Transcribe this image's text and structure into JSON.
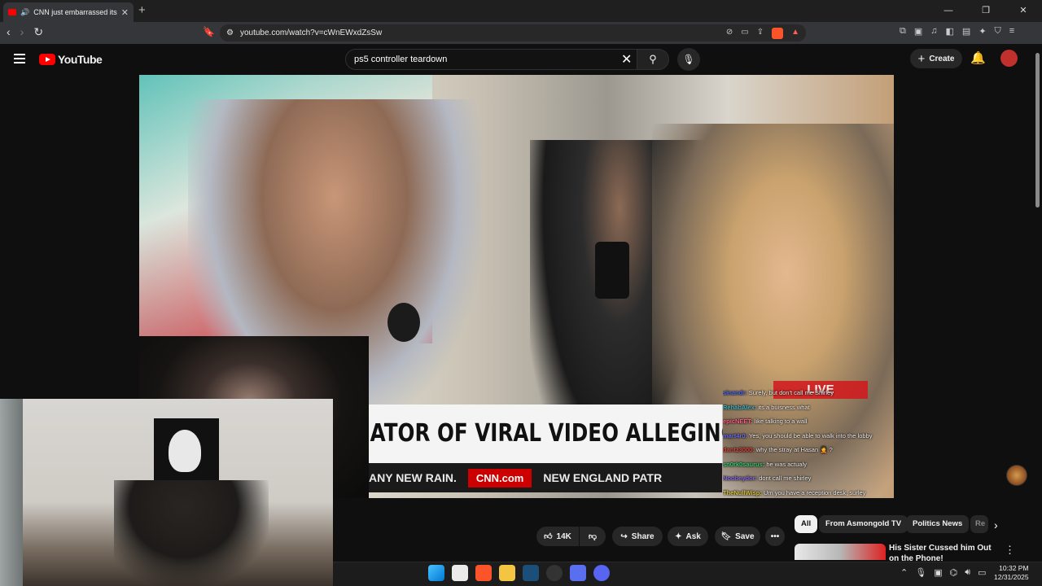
{
  "browser": {
    "tab_title": "CNN just embarrassed itself..",
    "tab_close": "✕",
    "new_tab": "+",
    "window_controls": [
      "—",
      "❐",
      "✕"
    ],
    "nav": [
      "‹",
      "›",
      "↻"
    ],
    "url": "youtube.com/watch?v=cWnEWxdZsSw"
  },
  "youtube": {
    "logo_text": "YouTube",
    "search_query": "ps5 controller teardown",
    "search_clear": "✕",
    "create_label": "Create",
    "create_plus": "+"
  },
  "video": {
    "chyron": "ATOR OF VIRAL VIDEO ALLEGING FRAUD IN MN",
    "ticker_pre": "ANY NEW RAIN.",
    "ticker_brand": "CNN.com",
    "ticker_post": "NEW ENGLAND PATR",
    "live_badge": "LIVE"
  },
  "chat": [
    {
      "user": "sinandr:",
      "msg": "Surely, but don't call me Shirley",
      "color": "#4b6bff"
    },
    {
      "user": "RehabAlex:",
      "msg": "its a buisness what",
      "color": "#3bb6c9"
    },
    {
      "user": "epicNEET:",
      "msg": "like talking to a wall",
      "color": "#ff5f8a"
    },
    {
      "user": "mart4r0:",
      "msg": "Yes, you should be able to walk into the lobby",
      "color": "#6e6ef0"
    },
    {
      "user": "dantz3000:",
      "msg": "why the stray at Hasan 🤦 ?",
      "color": "#e0463c"
    },
    {
      "user": "sn0rk0saurus:",
      "msg": "he was actualy",
      "color": "#2fcf6f"
    },
    {
      "user": "Noobeydor:",
      "msg": "dont call me shirley",
      "color": "#8a6be0"
    },
    {
      "user": "TheNullWisp:",
      "msg": "Um you have a reception desk, surley",
      "color": "#d9c23b"
    }
  ],
  "actions": {
    "like_count": "14K",
    "share": "Share",
    "ask": "Ask",
    "save": "Save",
    "more": "•••"
  },
  "chips": [
    "All",
    "From Asmongold TV",
    "Politics News",
    "Re"
  ],
  "recommended": {
    "title": "His Sister Cussed him Out on the Phone!"
  },
  "taskbar": {
    "time": "10:32 PM",
    "date": "12/31/2025"
  },
  "colors": {
    "yt_red": "#ff0000",
    "cnn_red": "#cc0000",
    "brave_orange": "#fb542b"
  }
}
